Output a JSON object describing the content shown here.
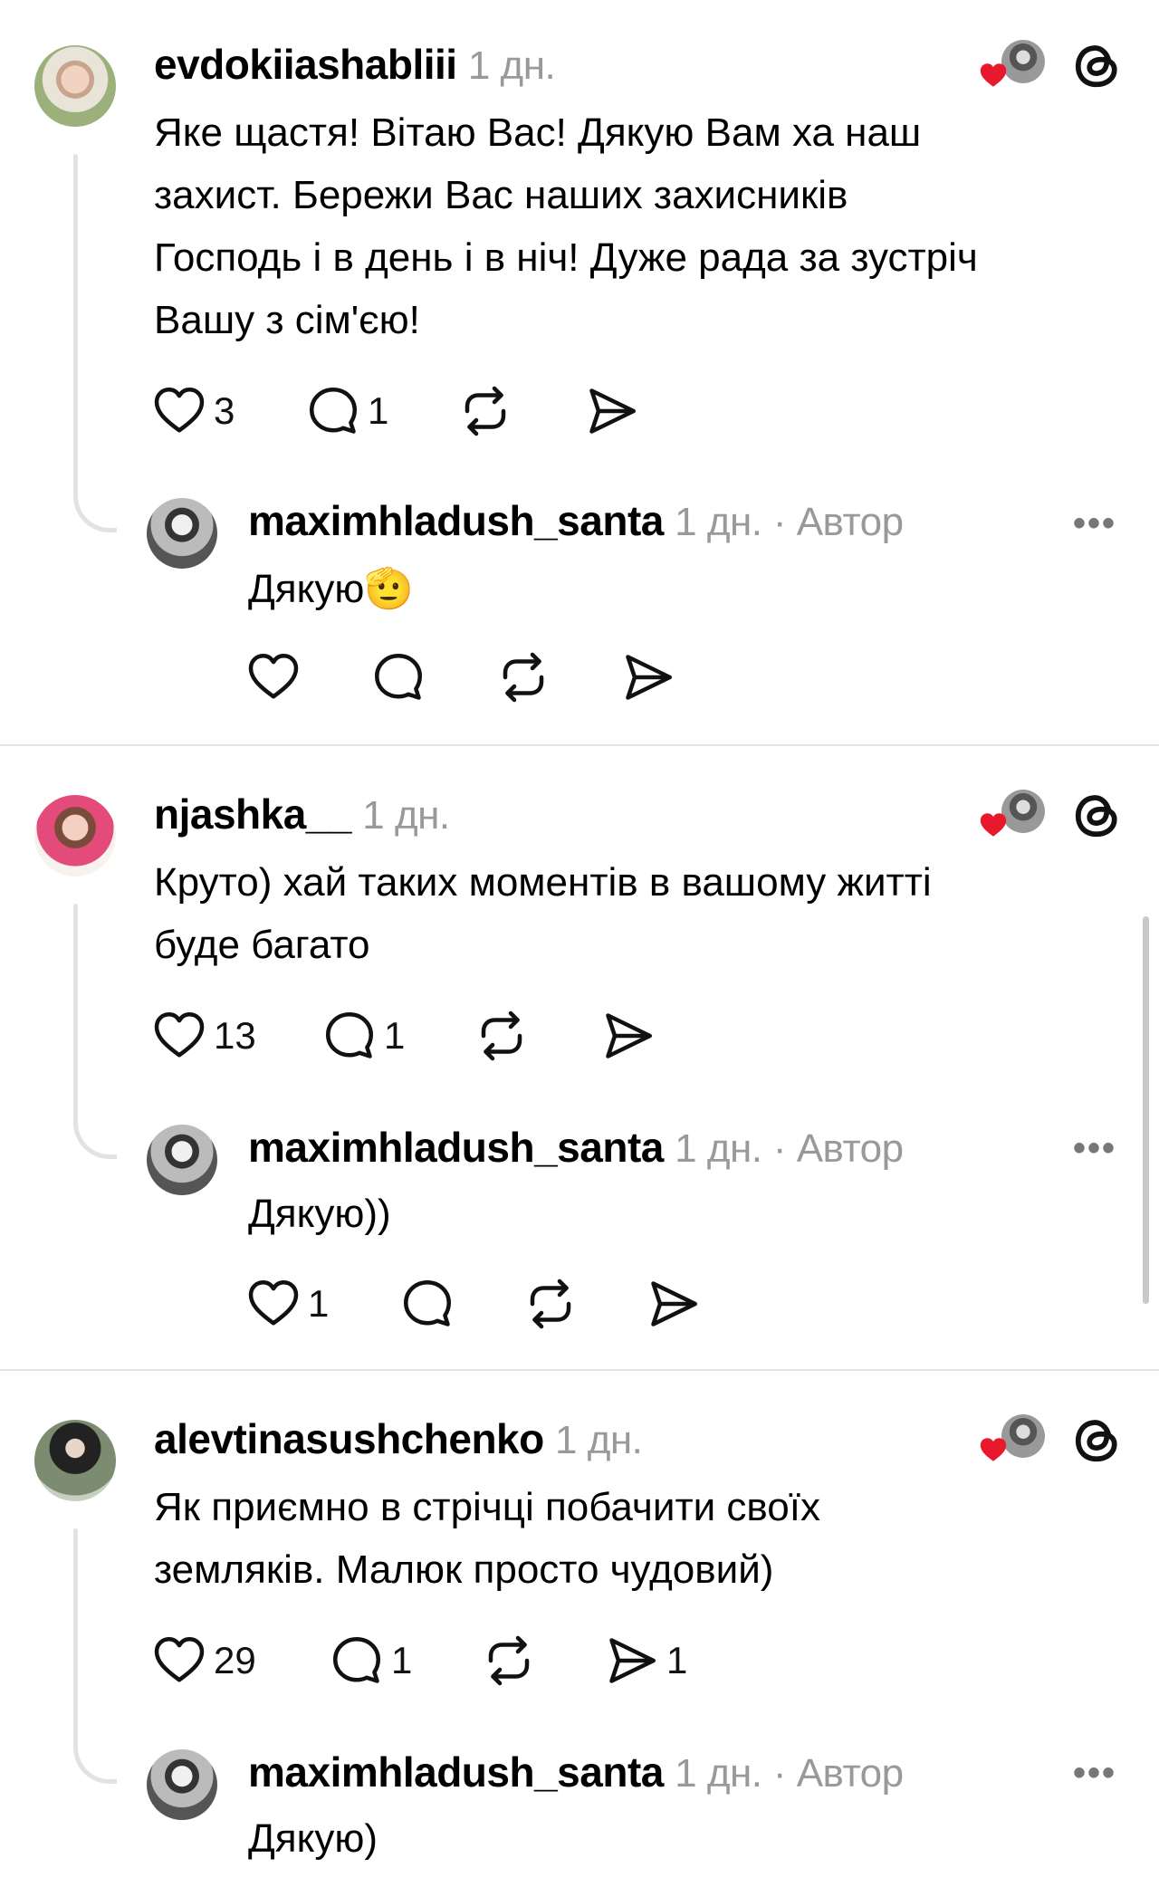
{
  "comments": [
    {
      "username": "evdokiiashabliii",
      "time": "1 дн.",
      "text_lines": [
        "Яке щастя! Вітаю Вас! Дякую Вам ха наш",
        "захист. Бережи Вас наших захисників",
        "Господь і в день і в ніч! Дуже рада за зустріч",
        "Вашу з сім'єю!"
      ],
      "likes": "3",
      "replies": "1",
      "shares": "",
      "reply": {
        "username": "maximhladush_santa",
        "time": "1 дн.",
        "role": "· Автор",
        "text": "Дякую",
        "emoji": "🫡",
        "likes": "",
        "more": "•••"
      }
    },
    {
      "username": "njashka__",
      "time": "1 дн.",
      "text_lines": [
        "Круто) хай таких моментів в вашому житті",
        "буде багато"
      ],
      "likes": "13",
      "replies": "1",
      "shares": "",
      "reply": {
        "username": "maximhladush_santa",
        "time": "1 дн.",
        "role": "· Автор",
        "text": "Дякую))",
        "emoji": "",
        "likes": "1",
        "more": "•••"
      }
    },
    {
      "username": "alevtinasushchenko",
      "time": "1 дн.",
      "text_lines": [
        "Як приємно в стрічці побачити своїх",
        "земляків. Малюк просто чудовий)"
      ],
      "likes": "29",
      "replies": "1",
      "shares": "1",
      "reply": {
        "username": "maximhladush_santa",
        "time": "1 дн.",
        "role": "· Автор",
        "text": "Дякую)",
        "emoji": "",
        "likes": "",
        "more": "•••"
      }
    }
  ],
  "icons": {
    "like": "heart-icon",
    "reply": "comment-bubble-icon",
    "repost": "repost-icon",
    "share": "send-icon",
    "app": "threads-logo-icon",
    "liked_by_author": "red-heart-icon"
  },
  "colors": {
    "liked_heart": "#e8192c",
    "meta_text": "#999999",
    "divider": "#e4e4e4"
  }
}
